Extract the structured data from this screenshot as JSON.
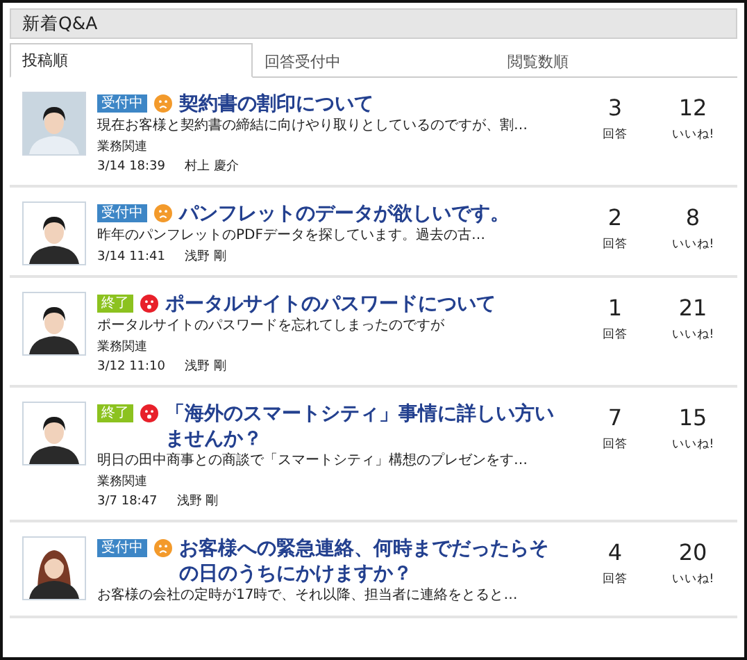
{
  "panel": {
    "title": "新着Q&A"
  },
  "tabs": [
    {
      "label": "投稿順",
      "selected": true
    },
    {
      "label": "回答受付中",
      "selected": false
    },
    {
      "label": "閲覧数順",
      "selected": false
    }
  ],
  "questions": [
    {
      "avatar": {
        "kind": "photo"
      },
      "status": {
        "kind": "open",
        "label": "受付中"
      },
      "mood_icon": {
        "kind": "frown",
        "color": "#f39a2b"
      },
      "title": "契約書の割印について",
      "snippet": "現在お客様と契約書の締結に向けやり取りとしているのですが、割…",
      "category": "業務関連",
      "date": "3/14 18:39",
      "author": "村上 慶介",
      "answers": "3",
      "answers_label": "回答",
      "likes": "12",
      "likes_label": "いいね!"
    },
    {
      "avatar": {
        "kind": "man"
      },
      "status": {
        "kind": "open",
        "label": "受付中"
      },
      "mood_icon": {
        "kind": "frown",
        "color": "#f39a2b"
      },
      "title": "パンフレットのデータが欲しいです。",
      "snippet": "昨年のパンフレットのPDFデータを探しています。過去の古…",
      "date": "3/14 11:41",
      "author": "浅野 剛",
      "answers": "2",
      "answers_label": "回答",
      "likes": "8",
      "likes_label": "いいね!"
    },
    {
      "avatar": {
        "kind": "man"
      },
      "status": {
        "kind": "closed",
        "label": "終了"
      },
      "mood_icon": {
        "kind": "distressed",
        "color": "#e8202a"
      },
      "title": "ポータルサイトのパスワードについて",
      "snippet": "ポータルサイトのパスワードを忘れてしまったのですが",
      "category": "業務関連",
      "date": "3/12 11:10",
      "author": "浅野 剛",
      "answers": "1",
      "answers_label": "回答",
      "likes": "21",
      "likes_label": "いいね!"
    },
    {
      "avatar": {
        "kind": "man"
      },
      "status": {
        "kind": "closed",
        "label": "終了"
      },
      "mood_icon": {
        "kind": "distressed",
        "color": "#e8202a"
      },
      "title": "「海外のスマートシティ」事情に詳しい方いませんか？",
      "snippet": "明日の田中商事との商談で「スマートシティ」構想のプレゼンをす…",
      "category": "業務関連",
      "date": "3/7 18:47",
      "author": "浅野 剛",
      "answers": "7",
      "answers_label": "回答",
      "likes": "15",
      "likes_label": "いいね!"
    },
    {
      "avatar": {
        "kind": "woman"
      },
      "status": {
        "kind": "open",
        "label": "受付中"
      },
      "mood_icon": {
        "kind": "frown",
        "color": "#f39a2b"
      },
      "title": "お客様への緊急連絡、何時までだったらその日のうちにかけますか？",
      "snippet": "お客様の会社の定時が17時で、それ以降、担当者に連絡をとると…",
      "answers": "4",
      "answers_label": "回答",
      "likes": "20",
      "likes_label": "いいね!"
    }
  ]
}
